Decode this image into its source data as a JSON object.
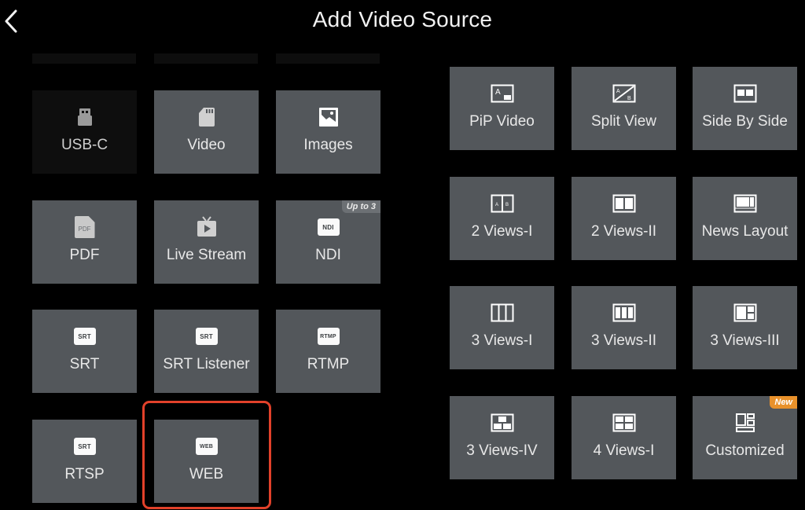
{
  "header": {
    "back_icon": "chevron-left-icon",
    "title": "Add Video Source"
  },
  "sources": [
    {
      "label": "USB-C",
      "icon": "usb-icon",
      "state": "disabled"
    },
    {
      "label": "Video",
      "icon": "sd-card-icon"
    },
    {
      "label": "Images",
      "icon": "image-icon"
    },
    {
      "label": "PDF",
      "icon": "pdf-file-icon",
      "icon_text": "PDF"
    },
    {
      "label": "Live Stream",
      "icon": "tv-play-icon"
    },
    {
      "label": "NDI",
      "icon": "ndi-icon",
      "icon_text": "NDI",
      "badge": "Up to 3"
    },
    {
      "label": "SRT",
      "icon": "srt-icon",
      "icon_text": "SRT"
    },
    {
      "label": "SRT Listener",
      "icon": "srt-icon",
      "icon_text": "SRT"
    },
    {
      "label": "RTMP",
      "icon": "rtmp-icon",
      "icon_text": "RTMP"
    },
    {
      "label": "RTSP",
      "icon": "srt-icon",
      "icon_text": "SRT"
    },
    {
      "label": "WEB",
      "icon": "web-icon",
      "icon_text": "WEB",
      "highlighted": true
    }
  ],
  "layouts": [
    {
      "label": "PiP Video",
      "icon": "pip-layout-icon"
    },
    {
      "label": "Split View",
      "icon": "split-view-layout-icon"
    },
    {
      "label": "Side By Side",
      "icon": "side-by-side-layout-icon"
    },
    {
      "label": "2 Views-I",
      "icon": "two-views-1-layout-icon"
    },
    {
      "label": "2 Views-II",
      "icon": "two-views-2-layout-icon"
    },
    {
      "label": "News Layout",
      "icon": "news-layout-icon"
    },
    {
      "label": "3 Views-I",
      "icon": "three-views-1-layout-icon"
    },
    {
      "label": "3 Views-II",
      "icon": "three-views-2-layout-icon"
    },
    {
      "label": "3 Views-III",
      "icon": "three-views-3-layout-icon"
    },
    {
      "label": "3 Views-IV",
      "icon": "three-views-4-layout-icon"
    },
    {
      "label": "4 Views-I",
      "icon": "four-views-layout-icon"
    },
    {
      "label": "Customized",
      "icon": "customized-layout-icon",
      "badge": "New"
    }
  ],
  "colors": {
    "tile_bg": "#53575b",
    "highlight": "#e2412a",
    "new_badge": "#e8912b"
  }
}
